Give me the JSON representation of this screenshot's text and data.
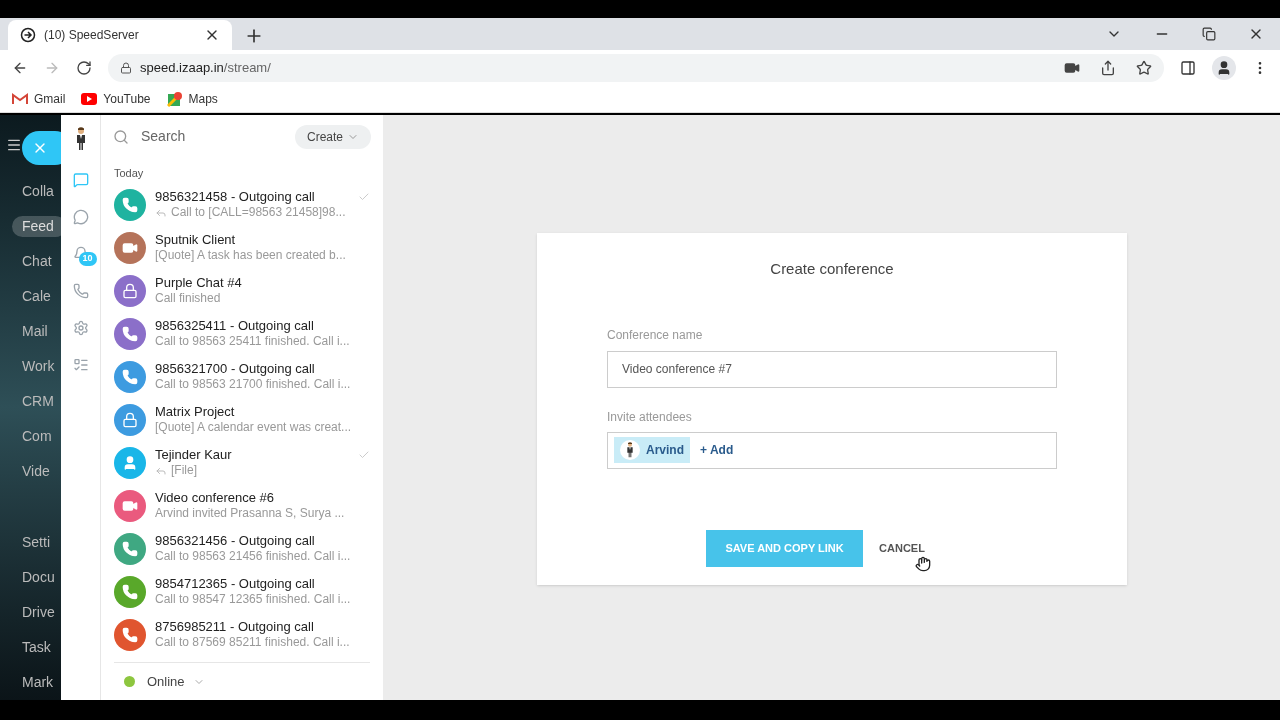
{
  "browser": {
    "tab_title": "(10) SpeedServer",
    "url_host": "speed.izaap.in",
    "url_path": "/stream/",
    "bookmarks": [
      {
        "label": "Gmail",
        "kind": "gmail"
      },
      {
        "label": "YouTube",
        "kind": "youtube"
      },
      {
        "label": "Maps",
        "kind": "maps"
      }
    ]
  },
  "side_menu": [
    {
      "label": "Colla",
      "selected": false
    },
    {
      "label": "Feed",
      "selected": true
    },
    {
      "label": "Chat",
      "selected": false
    },
    {
      "label": "Cale",
      "selected": false
    },
    {
      "label": "Mail",
      "selected": false
    },
    {
      "label": "Work",
      "selected": false
    },
    {
      "label": "CRM",
      "selected": false
    },
    {
      "label": "Com",
      "selected": false
    },
    {
      "label": "Vide",
      "selected": false
    },
    {
      "label": "Setti",
      "selected": false
    },
    {
      "label": "Docu",
      "selected": false
    },
    {
      "label": "Drive",
      "selected": false
    },
    {
      "label": "Task",
      "selected": false
    },
    {
      "label": "Mark",
      "selected": false
    }
  ],
  "rail": {
    "badge": "10",
    "items": [
      {
        "kind": "chat",
        "selected": true
      },
      {
        "kind": "channels",
        "selected": false
      },
      {
        "kind": "notifications",
        "selected": false
      },
      {
        "kind": "calls",
        "selected": false
      },
      {
        "kind": "settings",
        "selected": false
      },
      {
        "kind": "tasks",
        "selected": false
      }
    ]
  },
  "chat_list": {
    "search_placeholder": "Search",
    "create_label": "Create",
    "section": "Today",
    "status": {
      "label": "Online",
      "color": "#8dc63f"
    },
    "items": [
      {
        "title": "9856321458 - Outgoing call",
        "preview": "Call to [CALL=98563 21458]98...",
        "kind": "phone",
        "color": "#1fb3a0",
        "replied": true,
        "read": true
      },
      {
        "title": "Sputnik Client",
        "preview": "[Quote] A task has been created b...",
        "kind": "video",
        "color": "#b5735a",
        "replied": false,
        "read": false
      },
      {
        "title": "Purple Chat #4",
        "preview": "Call finished",
        "kind": "lock",
        "color": "#8b6fc9",
        "replied": false,
        "read": false
      },
      {
        "title": "9856325411 - Outgoing call",
        "preview": "Call to 98563 25411 finished. Call i...",
        "kind": "phone",
        "color": "#8b6fc9",
        "replied": false,
        "read": false
      },
      {
        "title": "9856321700 - Outgoing call",
        "preview": "Call to 98563 21700 finished. Call i...",
        "kind": "phone",
        "color": "#3d9be0",
        "replied": false,
        "read": false
      },
      {
        "title": "Matrix Project",
        "preview": "[Quote] A calendar event was creat...",
        "kind": "lock",
        "color": "#3d9be0",
        "replied": false,
        "read": false
      },
      {
        "title": "Tejinder Kaur",
        "preview": "[File]",
        "kind": "user",
        "color": "#19b6e8",
        "replied": true,
        "read": true
      },
      {
        "title": "Video conference #6",
        "preview": "Arvind invited Prasanna S, Surya ...",
        "kind": "video",
        "color": "#ea5a7e",
        "replied": false,
        "read": false
      },
      {
        "title": "9856321456 - Outgoing call",
        "preview": "Call to 98563 21456 finished. Call i...",
        "kind": "phone",
        "color": "#3fa882",
        "replied": false,
        "read": false
      },
      {
        "title": "9854712365 - Outgoing call",
        "preview": "Call to 98547 12365 finished. Call i...",
        "kind": "phone",
        "color": "#59a82a",
        "replied": false,
        "read": false
      },
      {
        "title": "8756985211 - Outgoing call",
        "preview": "Call to 87569 85211 finished. Call i...",
        "kind": "phone",
        "color": "#e0552f",
        "replied": false,
        "read": false
      }
    ]
  },
  "dialog": {
    "title": "Create conference",
    "name_label": "Conference name",
    "name_value": "Video conference #7",
    "invite_label": "Invite attendees",
    "attendees": [
      "Arvind"
    ],
    "add_label": "+ Add",
    "save_label": "SAVE AND COPY LINK",
    "cancel_label": "CANCEL"
  }
}
